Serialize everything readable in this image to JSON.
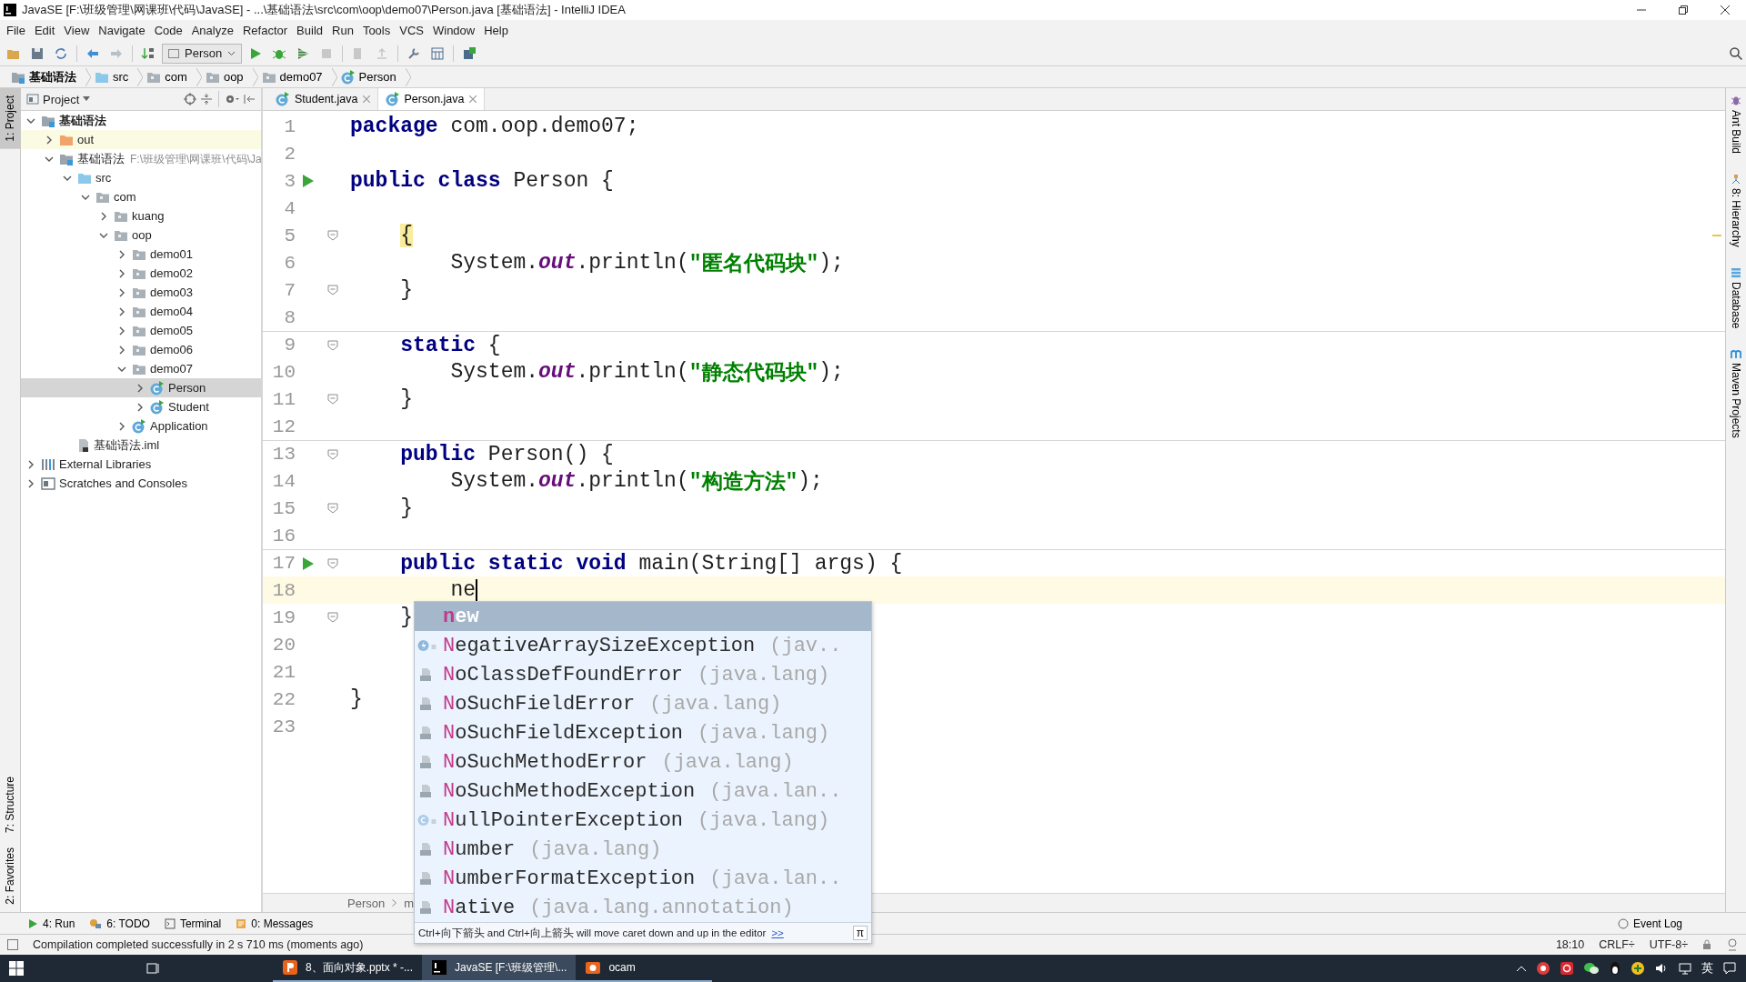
{
  "window": {
    "title": "JavaSE [F:\\班级管理\\网课班\\代码\\JavaSE] - ...\\基础语法\\src\\com\\oop\\demo07\\Person.java [基础语法] - IntelliJ IDEA"
  },
  "menu": [
    "File",
    "Edit",
    "View",
    "Navigate",
    "Code",
    "Analyze",
    "Refactor",
    "Build",
    "Run",
    "Tools",
    "VCS",
    "Window",
    "Help"
  ],
  "toolbar": {
    "run_config": "Person"
  },
  "navbar": [
    {
      "label": "基础语法",
      "kind": "module"
    },
    {
      "label": "src",
      "kind": "folder_source"
    },
    {
      "label": "com",
      "kind": "package"
    },
    {
      "label": "oop",
      "kind": "package"
    },
    {
      "label": "demo07",
      "kind": "package"
    },
    {
      "label": "Person",
      "kind": "class"
    }
  ],
  "left_strip": {
    "top": [
      {
        "label": "1: Project",
        "selected": true
      }
    ],
    "bottom": [
      {
        "label": "7: Structure",
        "selected": false
      },
      {
        "label": "2: Favorites",
        "selected": false
      }
    ]
  },
  "right_strip": [
    {
      "label": "Ant Build",
      "kind": "ant"
    },
    {
      "label": "8: Hierarchy",
      "kind": "hierarchy"
    },
    {
      "label": "Database",
      "kind": "database"
    },
    {
      "label": "Maven Projects",
      "kind": "maven"
    }
  ],
  "project_panel": {
    "title": "Project",
    "tree": [
      {
        "label": "基础语法",
        "kind": "module",
        "expanded": true,
        "selected": false,
        "children": [
          {
            "label": "out",
            "kind": "folder_excluded",
            "expanded": false,
            "selected": false
          },
          {
            "label": "基础语法",
            "path": "F:\\班级管理\\网课班\\代码\\Ja",
            "kind": "module",
            "expanded": true,
            "selected": false,
            "children": [
              {
                "label": "src",
                "kind": "folder_source",
                "expanded": true,
                "selected": false,
                "children": [
                  {
                    "label": "com",
                    "kind": "package",
                    "expanded": true,
                    "selected": false,
                    "children": [
                      {
                        "label": "kuang",
                        "kind": "package",
                        "expanded": false,
                        "selected": false
                      },
                      {
                        "label": "oop",
                        "kind": "package",
                        "expanded": true,
                        "selected": false,
                        "children": [
                          {
                            "label": "demo01",
                            "kind": "package",
                            "expanded": false,
                            "selected": false
                          },
                          {
                            "label": "demo02",
                            "kind": "package",
                            "expanded": false,
                            "selected": false
                          },
                          {
                            "label": "demo03",
                            "kind": "package",
                            "expanded": false,
                            "selected": false
                          },
                          {
                            "label": "demo04",
                            "kind": "package",
                            "expanded": false,
                            "selected": false
                          },
                          {
                            "label": "demo05",
                            "kind": "package",
                            "expanded": false,
                            "selected": false
                          },
                          {
                            "label": "demo06",
                            "kind": "package",
                            "expanded": false,
                            "selected": false
                          },
                          {
                            "label": "demo07",
                            "kind": "package",
                            "expanded": true,
                            "selected": false,
                            "children": [
                              {
                                "label": "Person",
                                "kind": "class",
                                "expanded": false,
                                "selected": true
                              },
                              {
                                "label": "Student",
                                "kind": "class",
                                "expanded": false,
                                "selected": false
                              }
                            ]
                          },
                          {
                            "label": "Application",
                            "kind": "class",
                            "expanded": false,
                            "selected": false
                          }
                        ]
                      }
                    ]
                  }
                ]
              },
              {
                "label": "基础语法.iml",
                "kind": "iml",
                "selected": false
              }
            ]
          }
        ]
      },
      {
        "label": "External Libraries",
        "kind": "libraries",
        "expanded": false,
        "selected": false
      },
      {
        "label": "Scratches and Consoles",
        "kind": "scratches",
        "expanded": false,
        "selected": false
      }
    ]
  },
  "editor": {
    "tabs": [
      {
        "label": "Student.java",
        "selected": false
      },
      {
        "label": "Person.java",
        "selected": true
      }
    ],
    "lines": [
      {
        "number": "1",
        "run": false,
        "fold": false,
        "separator_above": false,
        "current": false,
        "tokens": [
          {
            "kind": "keyword",
            "text": "package"
          },
          {
            "kind": "plain",
            "text": " com.oop.demo07;"
          }
        ]
      },
      {
        "number": "2",
        "run": false,
        "fold": false,
        "separator_above": false,
        "current": false
      },
      {
        "number": "3",
        "run": true,
        "fold": false,
        "separator_above": false,
        "current": false,
        "tokens": [
          {
            "kind": "keyword",
            "text": "public class"
          },
          {
            "kind": "plain",
            "text": " Person {"
          }
        ]
      },
      {
        "number": "4",
        "run": false,
        "fold": false,
        "separator_above": false,
        "current": false
      },
      {
        "number": "5",
        "run": false,
        "fold": true,
        "separator_above": false,
        "current": false,
        "tokens": [
          {
            "kind": "brace_match",
            "text": "    {"
          }
        ]
      },
      {
        "number": "6",
        "run": false,
        "fold": false,
        "separator_above": false,
        "current": false,
        "tokens": [
          {
            "kind": "plain",
            "text": "        System."
          },
          {
            "kind": "static_field",
            "text": "out"
          },
          {
            "kind": "plain",
            "text": ".println("
          },
          {
            "kind": "string",
            "text": "\"匿名代码块\""
          },
          {
            "kind": "plain",
            "text": ");"
          }
        ]
      },
      {
        "number": "7",
        "run": false,
        "fold": true,
        "separator_above": false,
        "current": false,
        "tokens": [
          {
            "kind": "plain",
            "text": "    }"
          }
        ]
      },
      {
        "number": "8",
        "run": false,
        "fold": false,
        "separator_above": false,
        "current": false
      },
      {
        "number": "9",
        "run": false,
        "fold": true,
        "separator_above": true,
        "current": false,
        "tokens": [
          {
            "kind": "keyword",
            "text": "    static"
          },
          {
            "kind": "plain",
            "text": " {"
          }
        ]
      },
      {
        "number": "10",
        "run": false,
        "fold": false,
        "separator_above": false,
        "current": false,
        "tokens": [
          {
            "kind": "plain",
            "text": "        System."
          },
          {
            "kind": "static_field",
            "text": "out"
          },
          {
            "kind": "plain",
            "text": ".println("
          },
          {
            "kind": "string",
            "text": "\"静态代码块\""
          },
          {
            "kind": "plain",
            "text": ");"
          }
        ]
      },
      {
        "number": "11",
        "run": false,
        "fold": true,
        "separator_above": false,
        "current": false,
        "tokens": [
          {
            "kind": "plain",
            "text": "    }"
          }
        ]
      },
      {
        "number": "12",
        "run": false,
        "fold": false,
        "separator_above": false,
        "current": false
      },
      {
        "number": "13",
        "run": false,
        "fold": true,
        "separator_above": true,
        "current": false,
        "tokens": [
          {
            "kind": "keyword",
            "text": "    public"
          },
          {
            "kind": "plain",
            "text": " Person() {"
          }
        ]
      },
      {
        "number": "14",
        "run": false,
        "fold": false,
        "separator_above": false,
        "current": false,
        "tokens": [
          {
            "kind": "plain",
            "text": "        System."
          },
          {
            "kind": "static_field",
            "text": "out"
          },
          {
            "kind": "plain",
            "text": ".println("
          },
          {
            "kind": "string",
            "text": "\"构造方法\""
          },
          {
            "kind": "plain",
            "text": ");"
          }
        ]
      },
      {
        "number": "15",
        "run": false,
        "fold": true,
        "separator_above": false,
        "current": false,
        "tokens": [
          {
            "kind": "plain",
            "text": "    }"
          }
        ]
      },
      {
        "number": "16",
        "run": false,
        "fold": false,
        "separator_above": false,
        "current": false
      },
      {
        "number": "17",
        "run": true,
        "fold": true,
        "separator_above": true,
        "current": false,
        "tokens": [
          {
            "kind": "keyword",
            "text": "    public static void"
          },
          {
            "kind": "plain",
            "text": " main(String[] args) {"
          }
        ]
      },
      {
        "number": "18",
        "run": false,
        "fold": false,
        "separator_above": false,
        "current": true,
        "tokens": [
          {
            "kind": "plain",
            "text": "        ne"
          }
        ]
      },
      {
        "number": "19",
        "run": false,
        "fold": true,
        "separator_above": false,
        "current": false,
        "tokens": [
          {
            "kind": "plain",
            "text": "    }"
          }
        ]
      },
      {
        "number": "20",
        "run": false,
        "fold": false,
        "separator_above": false,
        "current": false
      },
      {
        "number": "21",
        "run": false,
        "fold": false,
        "separator_above": false,
        "current": false
      },
      {
        "number": "22",
        "run": false,
        "fold": false,
        "separator_above": false,
        "current": false,
        "tokens": [
          {
            "kind": "plain",
            "text": "}"
          }
        ]
      },
      {
        "number": "23",
        "run": false,
        "fold": false,
        "separator_above": false,
        "current": false
      }
    ],
    "breadcrumb": [
      "Person",
      "m"
    ]
  },
  "completion": {
    "items": [
      {
        "kind": "keyword",
        "match": "n",
        "rest": "ew",
        "selected": true
      },
      {
        "kind": "exception",
        "match": "N",
        "rest": "egativeArraySizeException",
        "package": "(jav..",
        "selected": false
      },
      {
        "kind": "class_file",
        "match": "N",
        "rest": "oClassDefFoundError",
        "package": "(java.lang)",
        "selected": false
      },
      {
        "kind": "class_file",
        "match": "N",
        "rest": "oSuchFieldError",
        "package": "(java.lang)",
        "selected": false
      },
      {
        "kind": "class_file",
        "match": "N",
        "rest": "oSuchFieldException",
        "package": "(java.lang)",
        "selected": false
      },
      {
        "kind": "class_file",
        "match": "N",
        "rest": "oSuchMethodError",
        "package": "(java.lang)",
        "selected": false
      },
      {
        "kind": "class_file",
        "match": "N",
        "rest": "oSuchMethodException",
        "package": "(java.lan..",
        "selected": false
      },
      {
        "kind": "class",
        "match": "N",
        "rest": "ullPointerException",
        "package": "(java.lang)",
        "selected": false
      },
      {
        "kind": "class_file",
        "match": "N",
        "rest": "umber",
        "package": "(java.lang)",
        "selected": false
      },
      {
        "kind": "class_file",
        "match": "N",
        "rest": "umberFormatException",
        "package": "(java.lan..",
        "selected": false
      },
      {
        "kind": "class_file",
        "match": "N",
        "rest": "ative",
        "package": "(java.lang.annotation)",
        "selected": false
      }
    ],
    "hint": "Ctrl+向下箭头 and Ctrl+向上箭头 will move caret down and up in the editor",
    "hint_link": ">>",
    "pi": "π"
  },
  "tool_tabs": [
    {
      "label": "4: Run",
      "kind": "run"
    },
    {
      "label": "6: TODO",
      "kind": "todo"
    },
    {
      "label": "Terminal",
      "kind": "terminal"
    },
    {
      "label": "0: Messages",
      "kind": "messages"
    }
  ],
  "event_log": "Event Log",
  "status_bar": {
    "message": "Compilation completed successfully in 2 s 710 ms (moments ago)",
    "position": "18:10",
    "line_separator": "CRLF÷",
    "encoding": "UTF-8÷"
  },
  "taskbar": {
    "apps": [
      {
        "label": "8、面向对象.pptx * -...",
        "kind": "powerpoint",
        "selected": false
      },
      {
        "label": "JavaSE [F:\\班级管理\\...",
        "kind": "intellij",
        "selected": true
      },
      {
        "label": "ocam",
        "kind": "ocam",
        "selected": false
      }
    ],
    "ime": "英"
  }
}
